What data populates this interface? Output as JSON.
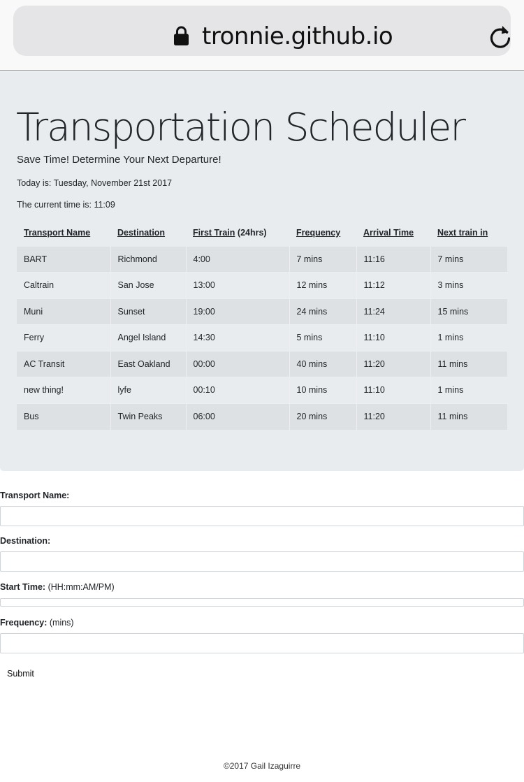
{
  "browser": {
    "url": "tronnie.github.io",
    "lock_icon": "lock-icon",
    "reload_icon": "reload-icon"
  },
  "header": {
    "title": "Transportation Scheduler",
    "subtitle": "Save Time! Determine Your Next Departure!",
    "today": "Today is: Tuesday, November 21st 2017",
    "current_time": "The current time is: 11:09"
  },
  "table": {
    "columns": [
      "Transport Name",
      "Destination",
      "First Train",
      "Frequency",
      "Arrival Time",
      "Next train in"
    ],
    "first_train_suffix": " (24hrs)",
    "rows": [
      [
        "BART",
        "Richmond",
        "4:00",
        "7 mins",
        "11:16",
        "7 mins"
      ],
      [
        "Caltrain",
        "San Jose",
        "13:00",
        "12 mins",
        "11:12",
        "3 mins"
      ],
      [
        "Muni",
        "Sunset",
        "19:00",
        "24 mins",
        "11:24",
        "15 mins"
      ],
      [
        "Ferry",
        "Angel Island",
        "14:30",
        "5 mins",
        "11:10",
        "1 mins"
      ],
      [
        "AC Transit",
        "East Oakland",
        "00:00",
        "40 mins",
        "11:20",
        "11 mins"
      ],
      [
        "new thing!",
        "lyfe",
        "00:10",
        "10 mins",
        "11:10",
        "1 mins"
      ],
      [
        "Bus",
        "Twin Peaks",
        "06:00",
        "20 mins",
        "11:20",
        "11 mins"
      ]
    ]
  },
  "form": {
    "transport_name_label": "Transport Name:",
    "transport_name_value": "",
    "destination_label": "Destination:",
    "destination_value": "",
    "start_time_label": "Start Time:",
    "start_time_hint": "(HH:mm:AM/PM)",
    "start_time_value": "",
    "frequency_label": "Frequency:",
    "frequency_hint": "(mins)",
    "frequency_value": "",
    "submit_label": "Submit"
  },
  "footer": {
    "copyright": "©2017 Gail Izaguirre"
  }
}
